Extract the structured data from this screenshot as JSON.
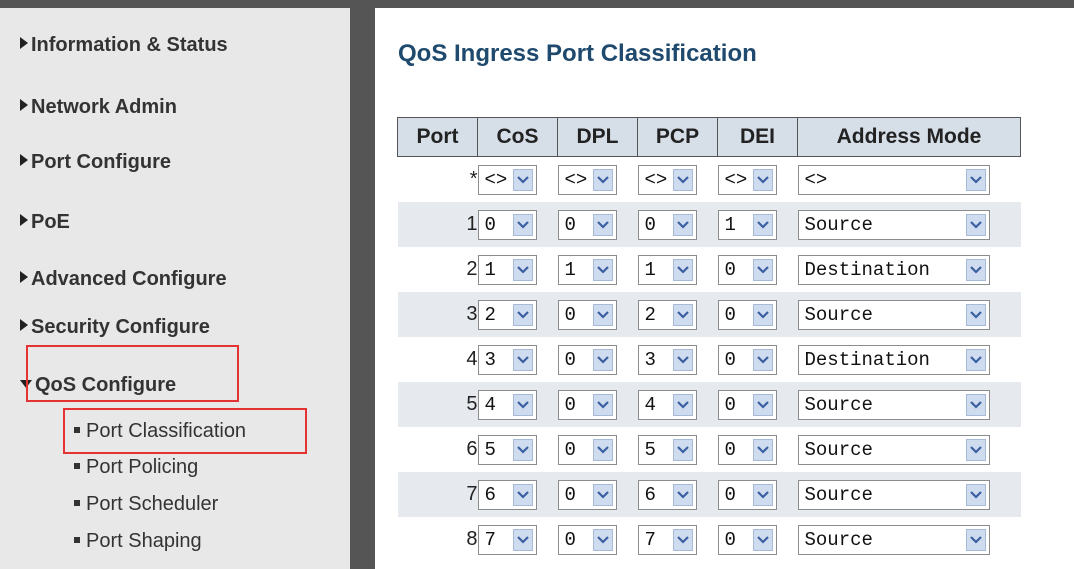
{
  "sidebar": {
    "items": [
      {
        "label": "Information & Status",
        "expanded": false
      },
      {
        "label": "Network Admin",
        "expanded": false
      },
      {
        "label": "Port Configure",
        "expanded": false
      },
      {
        "label": "PoE",
        "expanded": false
      },
      {
        "label": "Advanced Configure",
        "expanded": false
      },
      {
        "label": "Security Configure",
        "expanded": false
      },
      {
        "label": "QoS Configure",
        "expanded": true
      }
    ],
    "subitems": [
      {
        "label": "Port Classification",
        "highlighted": true
      },
      {
        "label": "Port Policing"
      },
      {
        "label": "Port Scheduler"
      },
      {
        "label": "Port Shaping"
      }
    ]
  },
  "main": {
    "title": "QoS Ingress Port Classification",
    "table": {
      "headers": [
        "Port",
        "CoS",
        "DPL",
        "PCP",
        "DEI",
        "Address Mode"
      ],
      "rows": [
        {
          "port": "*",
          "cos": "<>",
          "dpl": "<>",
          "pcp": "<>",
          "dei": "<>",
          "mode": "<>"
        },
        {
          "port": "1",
          "cos": "0",
          "dpl": "0",
          "pcp": "0",
          "dei": "1",
          "mode": "Source"
        },
        {
          "port": "2",
          "cos": "1",
          "dpl": "1",
          "pcp": "1",
          "dei": "0",
          "mode": "Destination"
        },
        {
          "port": "3",
          "cos": "2",
          "dpl": "0",
          "pcp": "2",
          "dei": "0",
          "mode": "Source"
        },
        {
          "port": "4",
          "cos": "3",
          "dpl": "0",
          "pcp": "3",
          "dei": "0",
          "mode": "Destination"
        },
        {
          "port": "5",
          "cos": "4",
          "dpl": "0",
          "pcp": "4",
          "dei": "0",
          "mode": "Source"
        },
        {
          "port": "6",
          "cos": "5",
          "dpl": "0",
          "pcp": "5",
          "dei": "0",
          "mode": "Source"
        },
        {
          "port": "7",
          "cos": "6",
          "dpl": "0",
          "pcp": "6",
          "dei": "0",
          "mode": "Source"
        },
        {
          "port": "8",
          "cos": "7",
          "dpl": "0",
          "pcp": "7",
          "dei": "0",
          "mode": "Source"
        }
      ]
    }
  },
  "icons": {
    "collapsed": "triangle-right-icon",
    "expanded": "triangle-down-icon",
    "bullet": "square-bullet-icon",
    "dropdown": "chevron-down-icon"
  },
  "colors": {
    "title": "#1f4a6e",
    "header_bg": "#d6dfe8",
    "highlight": "#e53333",
    "sidebar_bg": "#e8e8e8",
    "divider": "#555555"
  }
}
